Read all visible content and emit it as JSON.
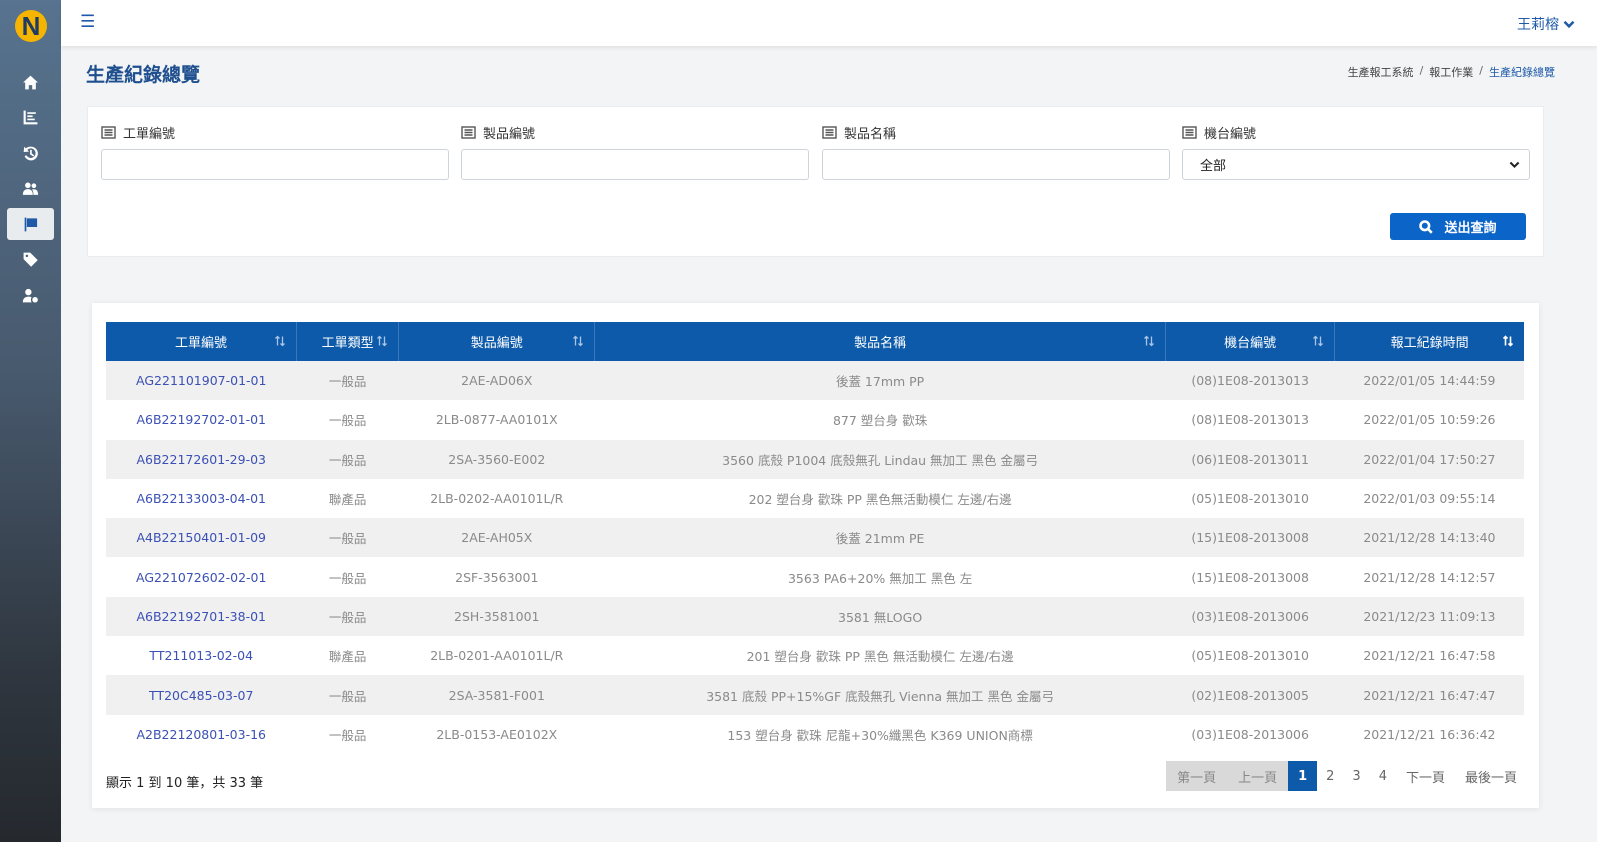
{
  "app": {
    "logo_letter": "N",
    "user_name": "王莉榕"
  },
  "sidebar": {
    "items": [
      {
        "name": "home",
        "icon": "home-icon",
        "active": false
      },
      {
        "name": "chart",
        "icon": "chart-icon",
        "active": false
      },
      {
        "name": "history",
        "icon": "history-icon",
        "active": false
      },
      {
        "name": "users",
        "icon": "users-icon",
        "active": false
      },
      {
        "name": "flag",
        "icon": "flag-icon",
        "active": true
      },
      {
        "name": "tag",
        "icon": "tag-icon",
        "active": false
      },
      {
        "name": "user-settings",
        "icon": "user-gear-icon",
        "active": false
      }
    ]
  },
  "page": {
    "title": "生產紀錄總覽",
    "breadcrumb": [
      "生產報工系統",
      "報工作業",
      "生產紀錄總覽"
    ]
  },
  "filters": {
    "work_order_label": "工單編號",
    "work_order_value": "",
    "product_no_label": "製品編號",
    "product_no_value": "",
    "product_name_label": "製品名稱",
    "product_name_value": "",
    "machine_label": "機台編號",
    "machine_selected": "全部",
    "submit_label": "送出查詢"
  },
  "table": {
    "headers": [
      "工單編號",
      "工單類型",
      "製品編號",
      "製品名稱",
      "機台編號",
      "報工紀錄時間"
    ],
    "rows": [
      [
        "AG221101907-01-01",
        "一般品",
        "2AE-AD06X",
        "後蓋 17mm PP",
        "(08)1E08-2013013",
        "2022/01/05 14:44:59"
      ],
      [
        "A6B22192702-01-01",
        "一般品",
        "2LB-0877-AA0101X",
        "877 塑台身 歡珠",
        "(08)1E08-2013013",
        "2022/01/05 10:59:26"
      ],
      [
        "A6B22172601-29-03",
        "一般品",
        "2SA-3560-E002",
        "3560 底殼 P1004 底殼無孔 Lindau 無加工 黑色 金屬弓",
        "(06)1E08-2013011",
        "2022/01/04 17:50:27"
      ],
      [
        "A6B22133003-04-01",
        "聯產品",
        "2LB-0202-AA0101L/R",
        "202 塑台身 歡珠 PP 黑色無活動模仁 左邊/右邊",
        "(05)1E08-2013010",
        "2022/01/03 09:55:14"
      ],
      [
        "A4B22150401-01-09",
        "一般品",
        "2AE-AH05X",
        "後蓋 21mm PE",
        "(15)1E08-2013008",
        "2021/12/28 14:13:40"
      ],
      [
        "AG221072602-02-01",
        "一般品",
        "2SF-3563001",
        "3563 PA6+20% 無加工 黑色 左",
        "(15)1E08-2013008",
        "2021/12/28 14:12:57"
      ],
      [
        "A6B22192701-38-01",
        "一般品",
        "2SH-3581001",
        "3581 無LOGO",
        "(03)1E08-2013006",
        "2021/12/23 11:09:13"
      ],
      [
        "TT211013-02-04",
        "聯產品",
        "2LB-0201-AA0101L/R",
        "201 塑台身 歡珠 PP 黑色 無活動模仁 左邊/右邊",
        "(05)1E08-2013010",
        "2021/12/21 16:47:58"
      ],
      [
        "TT20C485-03-07",
        "一般品",
        "2SA-3581-F001",
        "3581 底殼 PP+15%GF 底殼無孔 Vienna 無加工 黑色 金屬弓",
        "(02)1E08-2013005",
        "2021/12/21 16:47:47"
      ],
      [
        "A2B22120801-03-16",
        "一般品",
        "2LB-0153-AE0102X",
        "153 塑台身 歡珠 尼龍+30%纖黑色 K369 UNION商標",
        "(03)1E08-2013006",
        "2021/12/21 16:36:42"
      ]
    ],
    "summary": "顯示 1 到 10 筆，共 33 筆"
  },
  "pagination": {
    "first": "第一頁",
    "prev": "上一頁",
    "pages": [
      "1",
      "2",
      "3",
      "4"
    ],
    "current": "1",
    "next": "下一頁",
    "last": "最後一頁"
  }
}
